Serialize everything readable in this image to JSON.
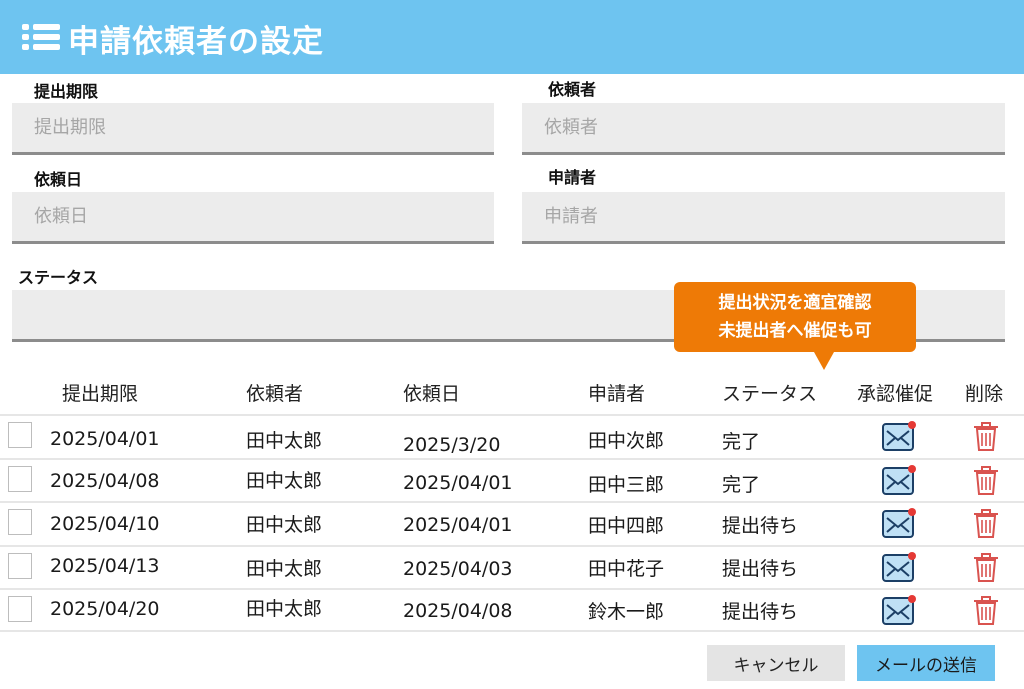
{
  "header": {
    "title": "申請依頼者の設定",
    "icon": "list-icon",
    "color": "#6ec4f0"
  },
  "form": {
    "deadline": {
      "label": "提出期限",
      "placeholder": "提出期限",
      "value": ""
    },
    "requester": {
      "label": "依頼者",
      "placeholder": "依頼者",
      "value": ""
    },
    "request_date": {
      "label": "依頼日",
      "placeholder": "依頼日",
      "value": ""
    },
    "applicant": {
      "label": "申請者",
      "placeholder": "申請者",
      "value": ""
    },
    "status": {
      "label": "ステータス",
      "placeholder": "",
      "value": ""
    }
  },
  "callout": {
    "line1": "提出状況を適宜確認",
    "line2": "未提出者へ催促も可",
    "color": "#ee7a06"
  },
  "table": {
    "columns": [
      "提出期限",
      "依頼者",
      "依頼日",
      "申請者",
      "ステータス",
      "承認催促",
      "削除"
    ],
    "rows": [
      {
        "deadline": "2025/04/01",
        "requester": "田中太郎",
        "request_date": "2025/3/20",
        "applicant": "田中次郎",
        "status": "完了"
      },
      {
        "deadline": "2025/04/08",
        "requester": "田中太郎",
        "request_date": "2025/04/01",
        "applicant": "田中三郎",
        "status": "完了"
      },
      {
        "deadline": "2025/04/10",
        "requester": "田中太郎",
        "request_date": "2025/04/01",
        "applicant": "田中四郎",
        "status": "提出待ち"
      },
      {
        "deadline": "2025/04/13",
        "requester": "田中太郎",
        "request_date": "2025/04/03",
        "applicant": "田中花子",
        "status": "提出待ち"
      },
      {
        "deadline": "2025/04/20",
        "requester": "田中太郎",
        "request_date": "2025/04/08",
        "applicant": "鈴木一郎",
        "status": "提出待ち"
      }
    ],
    "remind_icon": "mail-icon",
    "delete_icon": "trash-icon"
  },
  "buttons": {
    "cancel": "キャンセル",
    "send": "メールの送信"
  }
}
